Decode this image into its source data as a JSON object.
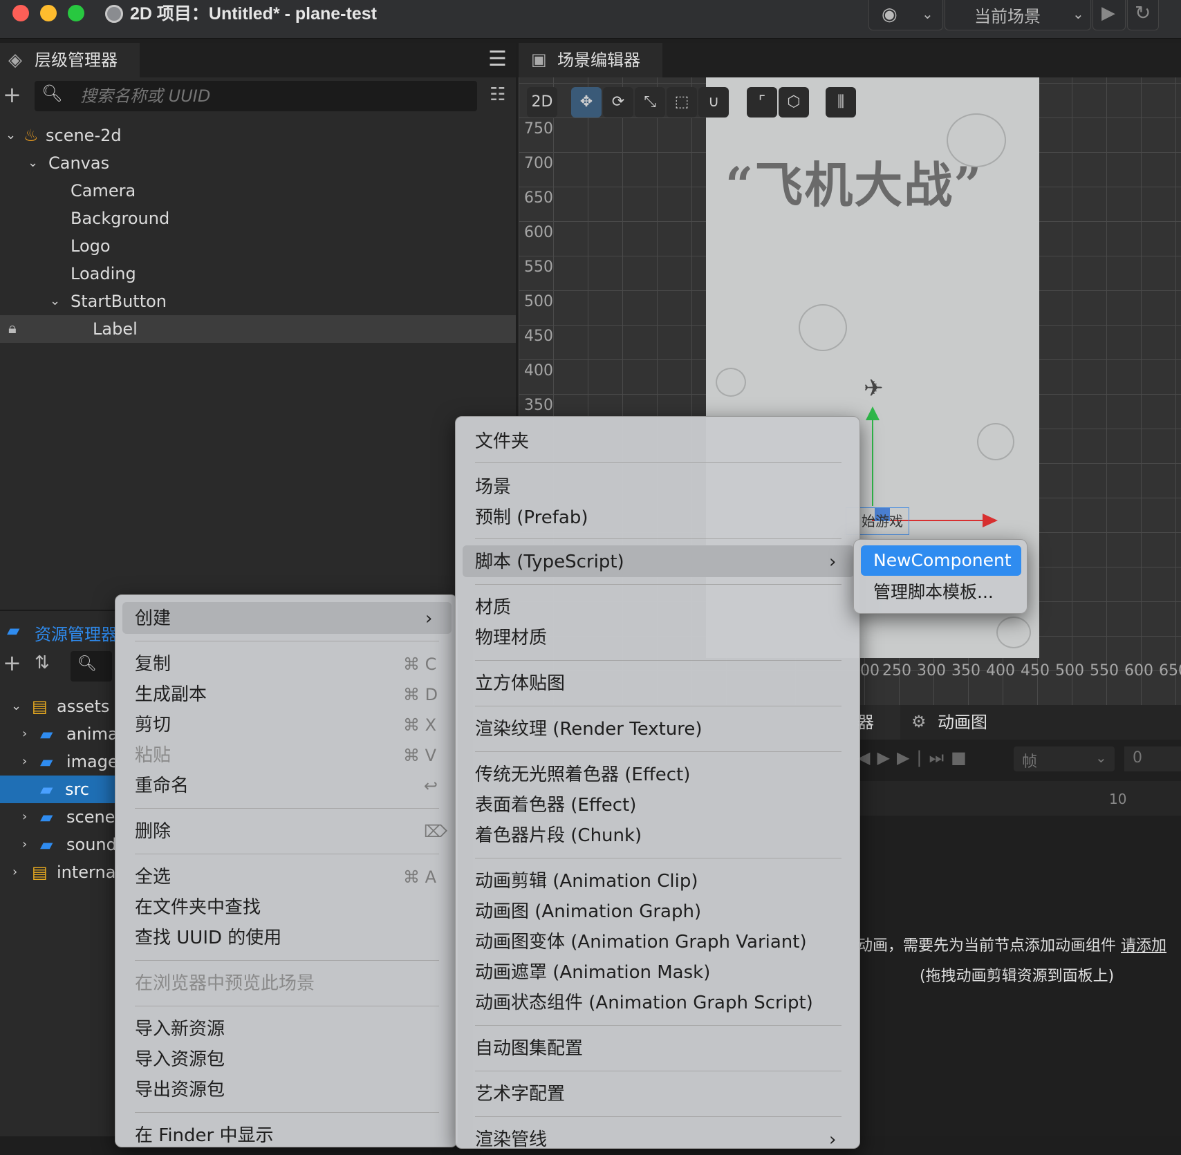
{
  "window": {
    "title": "2D 项目：Untitled* - plane-test",
    "scene_select": "当前场景"
  },
  "hierarchy": {
    "tab": "层级管理器",
    "search_placeholder": "搜索名称或 UUID",
    "tree": [
      {
        "label": "scene-2d"
      },
      {
        "label": "Canvas"
      },
      {
        "label": "Camera"
      },
      {
        "label": "Background"
      },
      {
        "label": "Logo"
      },
      {
        "label": "Loading"
      },
      {
        "label": "StartButton"
      },
      {
        "label": "Label"
      }
    ]
  },
  "scene_editor": {
    "tab": "场景编辑器",
    "mode": "2D",
    "y_ticks": [
      "750",
      "700",
      "650",
      "600",
      "550",
      "500",
      "450",
      "400",
      "350"
    ],
    "x_ticks": [
      "00",
      "250",
      "300",
      "350",
      "400",
      "450",
      "500",
      "550",
      "600",
      "650"
    ],
    "game_title": "“飞机大战”",
    "start_label": "始游戏"
  },
  "assets": {
    "tab": "资源管理器",
    "tree": [
      {
        "label": "assets"
      },
      {
        "label": "anima"
      },
      {
        "label": "image"
      },
      {
        "label": "src"
      },
      {
        "label": "scene"
      },
      {
        "label": "sound"
      },
      {
        "label": "internal"
      }
    ]
  },
  "animation": {
    "tab_partial": "器",
    "tab_graph": "动画图",
    "unit": "帧",
    "frame_value": "0",
    "ruler_mark": "10",
    "hint_line1": "动画，需要先为当前节点添加动画组件",
    "hint_link": "请添加",
    "hint_line2": "(拖拽动画剪辑资源到面板上)"
  },
  "context_menu": {
    "create": "创建",
    "copy": "复制",
    "copy_sc": "⌘ C",
    "duplicate": "生成副本",
    "duplicate_sc": "⌘ D",
    "cut": "剪切",
    "cut_sc": "⌘ X",
    "paste": "粘贴",
    "paste_sc": "⌘ V",
    "rename": "重命名",
    "rename_sc": "↩",
    "delete": "删除",
    "delete_sc": "⌦",
    "select_all": "全选",
    "select_all_sc": "⌘ A",
    "find_in_folder": "在文件夹中查找",
    "find_uuid": "查找 UUID 的使用",
    "preview_in_browser": "在浏览器中预览此场景",
    "import_asset": "导入新资源",
    "import_package": "导入资源包",
    "export_package": "导出资源包",
    "show_in_finder": "在 Finder 中显示"
  },
  "create_menu": {
    "folder": "文件夹",
    "scene": "场景",
    "prefab": "预制 (Prefab)",
    "script": "脚本 (TypeScript)",
    "material": "材质",
    "physics_material": "物理材质",
    "cubemap": "立方体贴图",
    "render_texture": "渲染纹理 (Render Texture)",
    "unlit_shader": "传统无光照着色器 (Effect)",
    "surface_shader": "表面着色器 (Effect)",
    "shader_chunk": "着色器片段 (Chunk)",
    "anim_clip": "动画剪辑 (Animation Clip)",
    "anim_graph": "动画图 (Animation Graph)",
    "anim_graph_variant": "动画图变体 (Animation Graph Variant)",
    "anim_mask": "动画遮罩 (Animation Mask)",
    "anim_graph_script": "动画状态组件 (Animation Graph Script)",
    "auto_atlas": "自动图集配置",
    "label_atlas": "艺术字配置",
    "render_pipeline": "渲染管线"
  },
  "script_menu": {
    "new_component": "NewComponent",
    "manage_templates": "管理脚本模板..."
  },
  "colors": {
    "accent": "#2f8cf0",
    "selected_row": "#1f6fb5"
  }
}
